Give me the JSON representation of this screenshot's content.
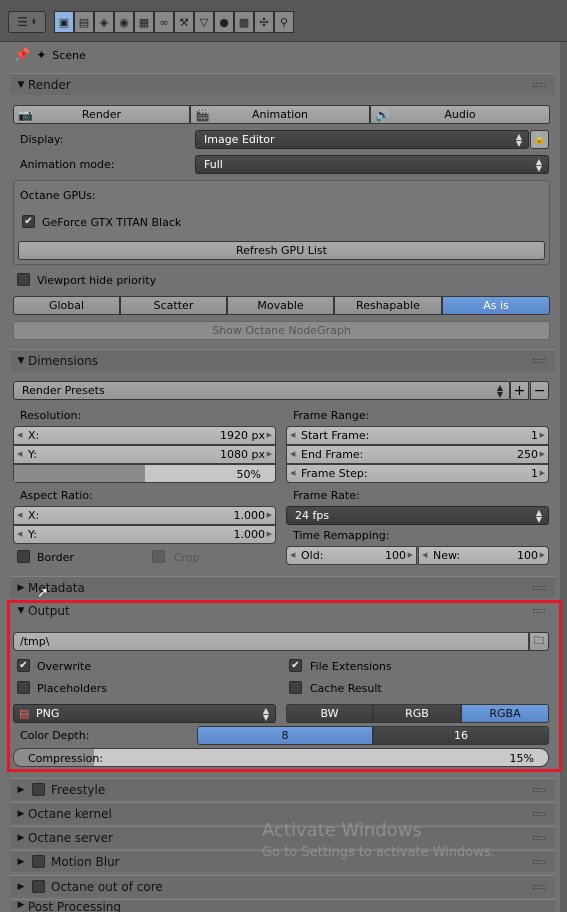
{
  "header": {
    "editor_icon": "properties-editor-icon",
    "tabs": [
      "render-icon",
      "render-layers-icon",
      "scene-icon",
      "world-icon",
      "object-icon",
      "constraints-icon",
      "modifiers-icon",
      "data-icon",
      "material-icon",
      "texture-icon",
      "particles-icon",
      "physics-icon"
    ]
  },
  "breadcrumb": {
    "pin_icon": "pin-icon",
    "scene_icon": "scene-icon",
    "label": "Scene"
  },
  "render": {
    "title": "Render",
    "buttons": [
      "Render",
      "Animation",
      "Audio"
    ],
    "display_label": "Display:",
    "display_value": "Image Editor",
    "anim_label": "Animation mode:",
    "anim_value": "Full",
    "gpus_label": "Octane GPUs:",
    "gpu_name": "GeForce GTX TITAN Black",
    "refresh_label": "Refresh GPU List",
    "viewport_label": "Viewport hide priority",
    "segments": [
      "Global",
      "Scatter",
      "Movable",
      "Reshapable",
      "As is"
    ],
    "segments_active": "As is",
    "nodegraph_label": "Show Octane NodeGraph"
  },
  "dimensions": {
    "title": "Dimensions",
    "presets": "Render Presets",
    "resolution_label": "Resolution:",
    "res_x_label": "X:",
    "res_x": "1920 px",
    "res_y_label": "Y:",
    "res_y": "1080 px",
    "res_pct": "50%",
    "res_pct_value": 0.5,
    "aspect_label": "Aspect Ratio:",
    "asp_x_label": "X:",
    "asp_x": "1.000",
    "asp_y_label": "Y:",
    "asp_y": "1.000",
    "border_label": "Border",
    "crop_label": "Crop",
    "frame_range_label": "Frame Range:",
    "start_label": "Start Frame:",
    "start": "1",
    "end_label": "End Frame:",
    "end": "250",
    "step_label": "Frame Step:",
    "step": "1",
    "frame_rate_label": "Frame Rate:",
    "fps": "24 fps",
    "remap_label": "Time Remapping:",
    "old_label": "Old:",
    "old": "100",
    "new_label": "New:",
    "new": "100"
  },
  "metadata": {
    "title": "Metadata"
  },
  "output": {
    "title": "Output",
    "path": "/tmp\\",
    "overwrite_label": "Overwrite",
    "file_ext_label": "File Extensions",
    "placeholders_label": "Placeholders",
    "cache_label": "Cache Result",
    "format": "PNG",
    "color_modes": [
      "BW",
      "RGB",
      "RGBA"
    ],
    "color_active": "RGBA",
    "depth_label": "Color Depth:",
    "depths": [
      "8",
      "16"
    ],
    "depth_active": "8",
    "compression_label": "Compression:",
    "compression": "15%",
    "compression_value": 0.15
  },
  "collapsed_panels": [
    {
      "title": "Freestyle",
      "has_check": true
    },
    {
      "title": "Octane kernel",
      "has_check": false
    },
    {
      "title": "Octane server",
      "has_check": false
    },
    {
      "title": "Motion Blur",
      "has_check": true
    },
    {
      "title": "Octane out of core",
      "has_check": true
    },
    {
      "title": "Post Processing",
      "has_check": false
    }
  ],
  "watermark": {
    "line1": "Activate Windows",
    "line2": "Go to Settings to activate Windows."
  },
  "colors": {
    "accent": "#5a87c9",
    "highlight": "#e3192b",
    "panel": "#727272"
  }
}
